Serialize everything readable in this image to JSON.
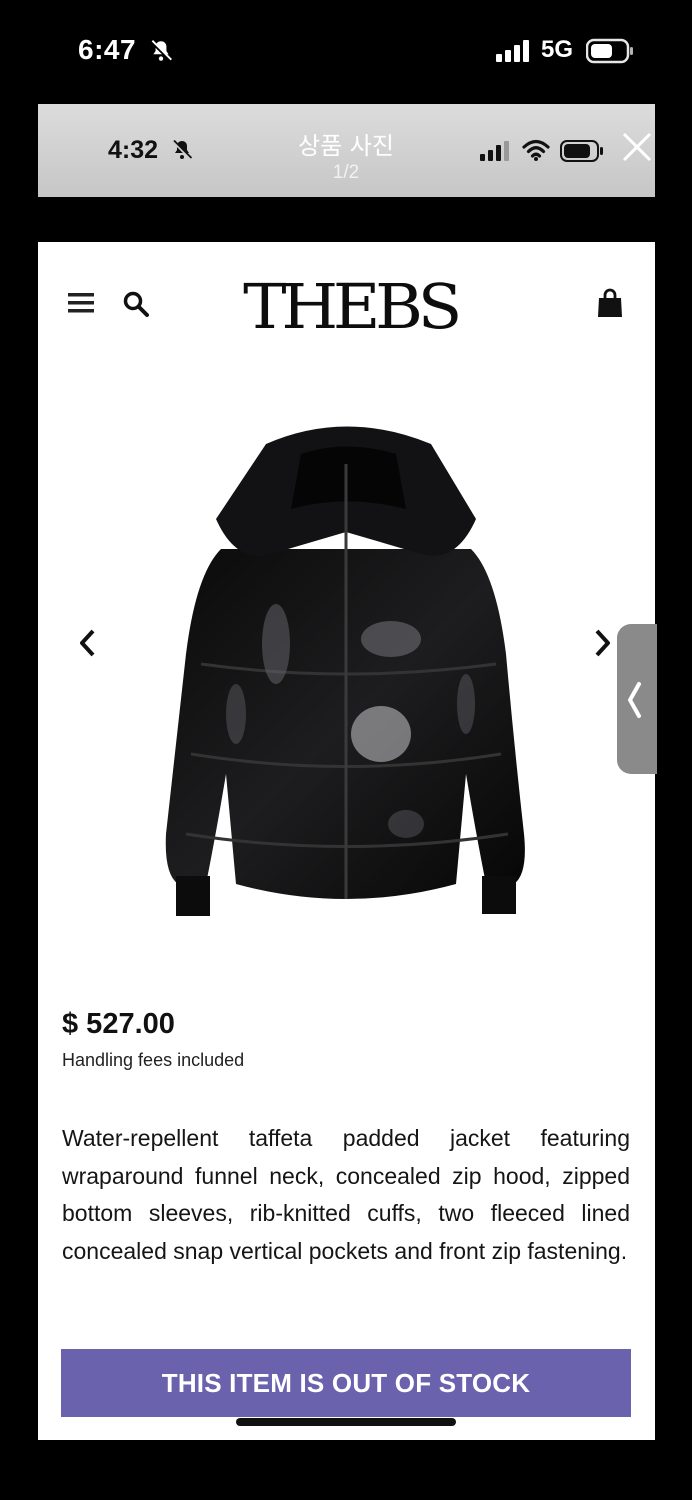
{
  "outer_status": {
    "time": "6:47",
    "network": "5G"
  },
  "viewer": {
    "time": "4:32",
    "title": "상품 사진",
    "counter": "1/2"
  },
  "store": {
    "logo": "THEBS",
    "price": "$ 527.00",
    "fees_note": "Handling fees included",
    "description": "Water-repellent taffeta padded jacket featuring wraparound funnel neck, concealed zip hood, zipped bottom sleeves, rib-knitted cuffs, two fleeced lined concealed snap vertical pockets and front zip fastening.",
    "stock_button": "THIS ITEM IS OUT OF STOCK"
  },
  "colors": {
    "button": "#6a62ad",
    "viewer_bar": "#d2d2d2",
    "handle": "#8a8a8a"
  },
  "icons": [
    "bell-slash-icon",
    "signal-icon",
    "wifi-icon",
    "battery-icon",
    "close-icon",
    "menu-icon",
    "search-icon",
    "shopping-bag-icon",
    "chevron-left-icon",
    "chevron-right-icon"
  ]
}
